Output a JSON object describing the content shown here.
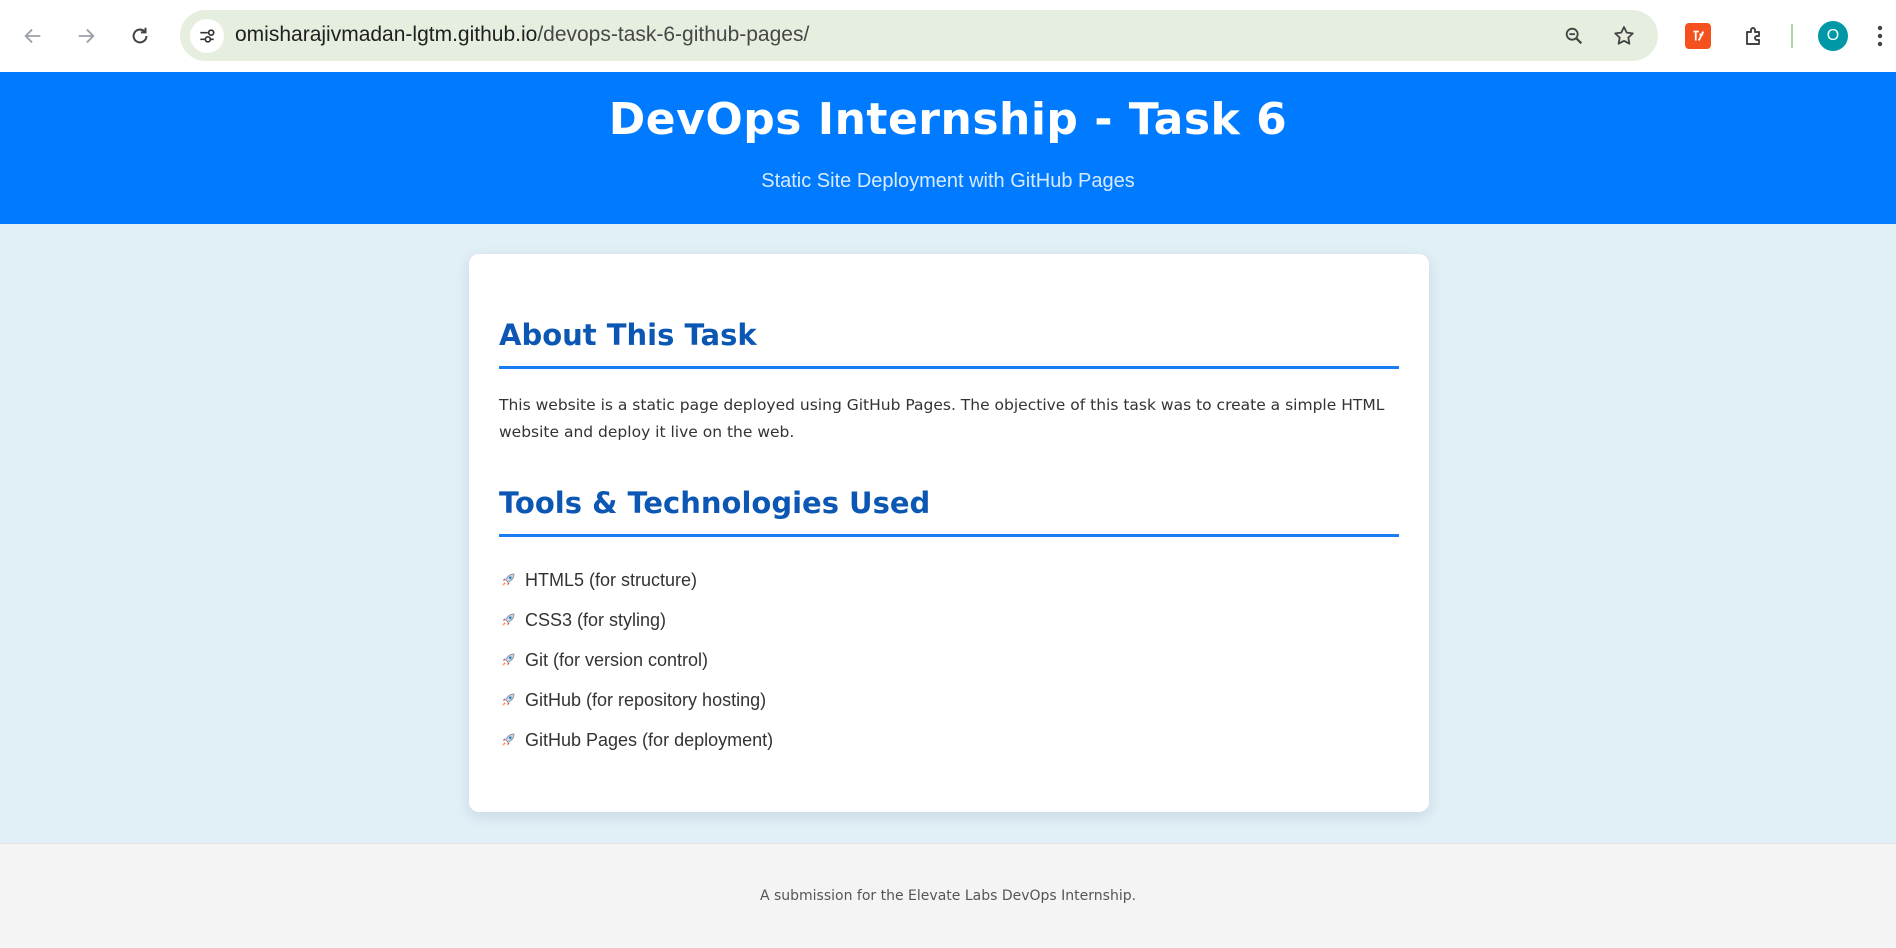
{
  "browser": {
    "url_domain": "omisharajivmadan-lgtm.github.io",
    "url_path": "/devops-task-6-github-pages/",
    "profile_initial": "O",
    "icons": [
      "back-icon",
      "forward-icon",
      "reload-icon",
      "site-info-icon",
      "zoom-icon",
      "bookmark-star-icon",
      "extension-icon",
      "extensions-puzzle-icon",
      "profile-avatar",
      "more-menu-icon"
    ]
  },
  "header": {
    "title": "DevOps Internship - Task 6",
    "subtitle": "Static Site Deployment with GitHub Pages",
    "background": "#007bff"
  },
  "about": {
    "heading": "About This Task",
    "text": "This website is a static page deployed using GitHub Pages. The objective of this task was to create a simple HTML website and deploy it live on the web."
  },
  "tools": {
    "heading": "Tools & Technologies Used",
    "bullet_icon": "rocket-icon",
    "items": [
      "HTML5 (for structure)",
      "CSS3 (for styling)",
      "Git (for version control)",
      "GitHub (for repository hosting)",
      "GitHub Pages (for deployment)"
    ]
  },
  "footer": {
    "text": "A submission for the Elevate Labs DevOps Internship."
  },
  "colors": {
    "page_background": "#e1eff6",
    "heading": "#0b57b3",
    "heading_rule": "#1a7ef2"
  }
}
